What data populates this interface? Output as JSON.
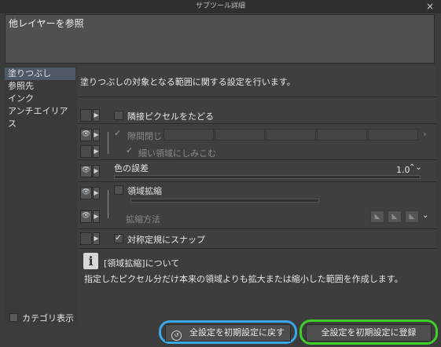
{
  "window": {
    "title": "サブツール詳細",
    "close_label": "×"
  },
  "name": "他レイヤーを参照",
  "categories": [
    "塗りつぶし",
    "参照先",
    "インク",
    "アンチエイリアス"
  ],
  "category_show_label": "カテゴリ表示",
  "description": "塗りつぶしの対象となる範囲に関する設定を行います。",
  "settings": {
    "adjacent": "隣接ピクセルをたどる",
    "gap_close": "隙間閉じ",
    "thin_area": "細い領域にしみこむ",
    "color_margin": "色の誤差",
    "color_margin_value": "1.0",
    "area_scaling": "領域拡縮",
    "scaling_method": "拡縮方法",
    "snap": "対称定規にスナップ"
  },
  "info": {
    "icon": "i",
    "title": "[領域拡縮]について",
    "body": "指定したピクセル分だけ本来の領域よりも拡大または縮小した範囲を作成します。"
  },
  "buttons": {
    "reset_all": "全設定を初期設定に戻す",
    "register_all": "全設定を初期設定に登録"
  },
  "colors": {
    "highlight_blue": "#3aa8e8",
    "highlight_green": "#3ecf2a",
    "selected_category": "#4f5866"
  }
}
